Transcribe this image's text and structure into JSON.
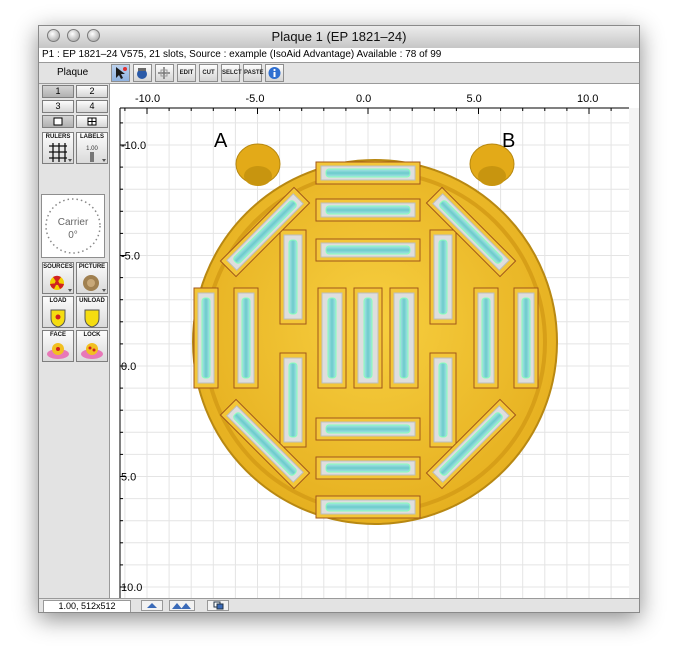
{
  "window": {
    "title": "Plaque 1 (EP 1821–24)",
    "info": "P1 : EP 1821–24 V575, 21 slots, Source : example (IsoAid Advantage) Available : 78 of 99"
  },
  "toolbar": {
    "plaque_label": "Plaque",
    "buttons": [
      {
        "name": "select-tool",
        "icon": "arrow-select-icon",
        "selected": true
      },
      {
        "name": "move-tool",
        "icon": "hand-icon"
      },
      {
        "name": "crosshair-tool",
        "icon": "crosshair-icon"
      },
      {
        "name": "edit",
        "label": "EDIT"
      },
      {
        "name": "cut",
        "label": "CUT"
      },
      {
        "name": "select",
        "label": "SELCT"
      },
      {
        "name": "paste",
        "label": "PASTE"
      },
      {
        "name": "info",
        "icon": "info-icon"
      }
    ]
  },
  "palette": {
    "num_buttons": [
      "1",
      "2",
      "3",
      "4"
    ],
    "rulers_label": "RULERS",
    "labels_label": "LABELS",
    "labels_sub": "1.00",
    "carrier_label": "Carrier",
    "carrier_angle": "0°",
    "sources_label": "SOURCES",
    "picture_label": "PICTURE",
    "load_label": "LOAD",
    "unload_label": "UNLOAD",
    "face_label": "FACE",
    "lock_label": "LOCK"
  },
  "canvas": {
    "x_ticks": [
      "-10.0",
      "-5.0",
      "0.0",
      "5.0",
      "10.0"
    ],
    "y_ticks": [
      "10.0",
      "5.0",
      "0.0",
      "-5.0",
      "-10.0"
    ],
    "label_a": "A",
    "label_b": "B",
    "colors": {
      "plaque": "#f0c030",
      "plaque_dark": "#c49012",
      "seed": "#7ecfd0",
      "grid": "#e4e4e4",
      "slot_border": "#a0561a"
    }
  },
  "status": {
    "zoom": "1.00, 512x512"
  }
}
